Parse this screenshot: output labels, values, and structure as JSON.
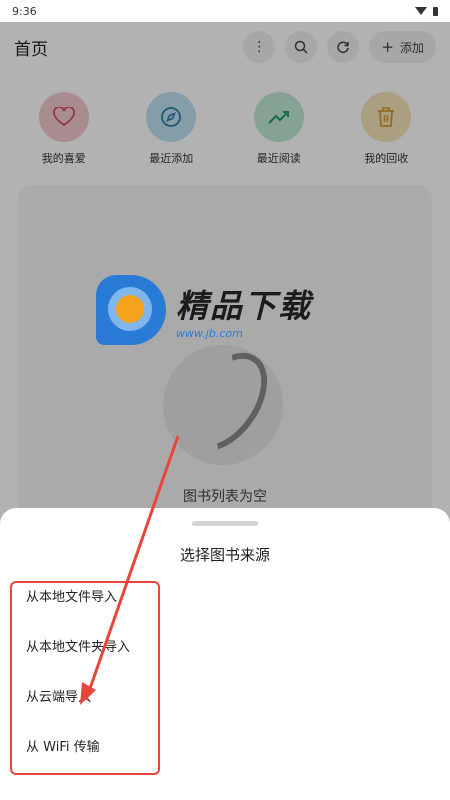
{
  "status_bar": {
    "time": "9:36"
  },
  "app_bar": {
    "title": "首页",
    "add_label": "添加"
  },
  "quick_access": [
    {
      "label": "我的喜爱",
      "icon": "heart-icon",
      "color": "#f2c9cd",
      "icon_color": "#d9505c"
    },
    {
      "label": "最近添加",
      "icon": "compass-icon",
      "color": "#bfe0f2",
      "icon_color": "#2f7fa8"
    },
    {
      "label": "最近阅读",
      "icon": "trend-up-icon",
      "color": "#bfe9d6",
      "icon_color": "#2a9a68"
    },
    {
      "label": "我的回收",
      "icon": "trash-icon",
      "color": "#f6e3b9",
      "icon_color": "#d29a2a"
    }
  ],
  "library": {
    "empty_text": "图书列表为空"
  },
  "watermark": {
    "title": "精品下载",
    "url": "www.jb.com"
  },
  "sheet": {
    "title": "选择图书来源",
    "options": [
      {
        "label": "从本地文件导入"
      },
      {
        "label": "从本地文件夹导入"
      },
      {
        "label": "从云端导入"
      },
      {
        "label": "从 WiFi 传输"
      }
    ]
  },
  "colors": {
    "annotation": "#e8453c",
    "overlay": "rgba(0,0,0,0.30)"
  }
}
